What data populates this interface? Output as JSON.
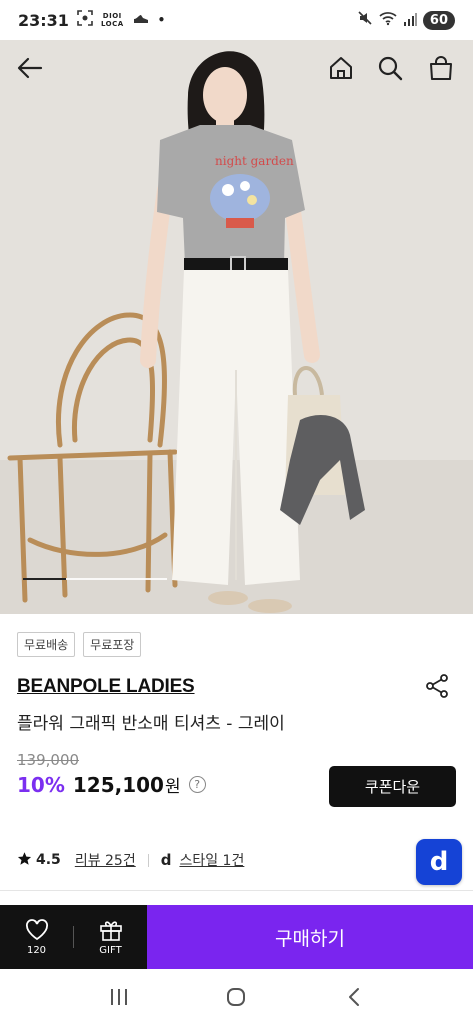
{
  "status_bar": {
    "time": "23:31",
    "dioi_top": "DIOI",
    "dioi_bottom": "LOCA",
    "dot": "•",
    "battery": "60",
    "icons": [
      "screenshot-icon",
      "shoe-icon",
      "mute-icon",
      "wifi-icon",
      "signal-icon"
    ]
  },
  "hero": {
    "nav_icons": [
      "back-arrow-icon",
      "home-icon",
      "search-icon",
      "shopping-bag-icon"
    ],
    "carousel_progress": 0.3
  },
  "product": {
    "badges": [
      "무료배송",
      "무료포장"
    ],
    "brand": "BEANPOLE LADIES",
    "name": "플라워 그래픽 반소매 티셔츠 - 그레이",
    "original_price": "139,000",
    "discount": "10%",
    "price": "125,100",
    "currency": "원",
    "help_label": "?",
    "coupon_label": "쿠폰다운"
  },
  "reviews": {
    "rating": "4.5",
    "review_link": "리뷰 25건",
    "style_mark": "d",
    "style_link": "스타일 1건"
  },
  "fab": {
    "label": "d"
  },
  "action_bar": {
    "like_count": "120",
    "gift_label": "GIFT",
    "buy_label": "구매하기"
  },
  "colors": {
    "accent_purple": "#7a25ef",
    "fab_blue": "#1543d6",
    "dark": "#121212"
  }
}
